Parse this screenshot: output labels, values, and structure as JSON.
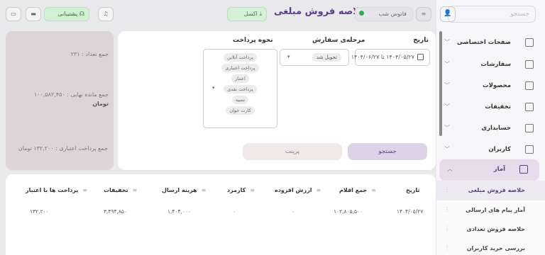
{
  "app": {
    "title": "خلاصه فروش مبلغی"
  },
  "topbar": {
    "support_label": "پشتیبانی",
    "night_mode_label": "فانوس شب",
    "excel_label": "اکسل",
    "icons": [
      "bell-icon",
      "monitor-icon",
      "chat-icon",
      "filter-icon",
      "user-icon"
    ]
  },
  "sidebar": {
    "search_placeholder": "جستجو",
    "items": [
      {
        "label": "صفحات اختصاصی",
        "icon": "grid-icon"
      },
      {
        "label": "سفارشات",
        "icon": "bag-icon"
      },
      {
        "label": "محصولات",
        "icon": "box-icon"
      },
      {
        "label": "تخفیفات",
        "icon": "discount-icon"
      },
      {
        "label": "حسابداری",
        "icon": "calc-icon"
      },
      {
        "label": "کاربران",
        "icon": "users-icon"
      },
      {
        "label": "آمار",
        "icon": "chart-icon"
      }
    ],
    "subitems": [
      {
        "label": "خلاصه فروش مبلغی",
        "active": true
      },
      {
        "label": "آمار پیام های ارسالی"
      },
      {
        "label": "خلاصه فروش تعدادی"
      },
      {
        "label": "بررسی خرید کاربران"
      }
    ]
  },
  "filters": {
    "date_label": "تاریخ",
    "date_value": "۱۴۰۴/۰۵/۲۷ تا ۱۴۰۴/۰۶/۲۷",
    "order_stage_label": "مرحله‌ی سفارش",
    "order_stage_value": "تحویل شد",
    "payment_label": "نحوه پرداخت",
    "payment_options": [
      "پرداخت آنلاین",
      "پرداخت اعتباری",
      "اعتبار",
      "پرداخت نقدی",
      "نسیه",
      "کارت خوان"
    ],
    "search_button": "جستجو",
    "print_button": "پرینت"
  },
  "stats": {
    "count": "جمع تعداد : ۲۳۱",
    "remaining_label": "جمع مانده نهایی : ۱۰۰,۵۸۲,۴۵۰",
    "remaining_unit": "تومان",
    "credit_total": "جمع پرداخت اعتباری : ۱۳۲,۲۰۰ تومان"
  },
  "table": {
    "headers": [
      "تاریخ",
      "جمع اقلام",
      "ارزش افزوده",
      "کارمزد",
      "هزینه ارسال",
      "تخفیفات",
      "پرداخت ها با اعتبار"
    ],
    "rows": [
      [
        "۱۴۰۴/۰۵/۲۷",
        "۱۰۲,۸۰۵,۵۰۰",
        "۰",
        "۰",
        "۱,۴۰۴,۰۰۰",
        "۳,۴۹۴,۸۵۰",
        "۱۳۲,۲۰۰"
      ]
    ]
  },
  "colors": {
    "accent": "#5b3d8c",
    "green_badge": "#d3f2d5",
    "search_btn": "#dcd4e6"
  }
}
